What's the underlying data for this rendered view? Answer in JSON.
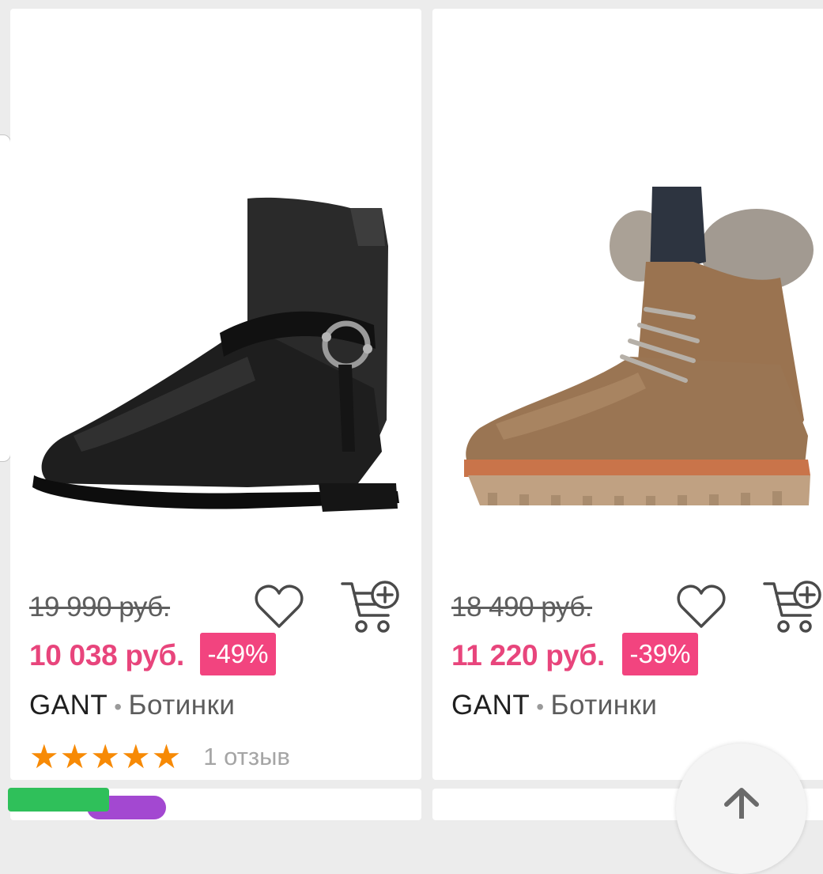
{
  "products": [
    {
      "image_alt": "Black leather ankle boot with harness strap",
      "old_price": "19 990 руб.",
      "new_price": "10 038 руб.",
      "discount": "-49%",
      "brand": "GANT",
      "separator": "•",
      "category": "Ботинки",
      "rating": {
        "stars": 5,
        "reviews_label": "1 отзыв"
      }
    },
    {
      "image_alt": "Tan suede lace-up boot with fur collar",
      "old_price": "18 490 руб.",
      "new_price": "11 220 руб.",
      "discount": "-39%",
      "brand": "GANT",
      "separator": "•",
      "category": "Ботинки"
    }
  ],
  "icons": {
    "favorite": "heart-outline-icon",
    "add_to_cart": "cart-plus-icon",
    "scroll_up": "arrow-up-icon",
    "star": "★"
  },
  "colors": {
    "sale_price": "#e8457c",
    "discount_badge": "#f2447f",
    "star": "#f78a05"
  }
}
